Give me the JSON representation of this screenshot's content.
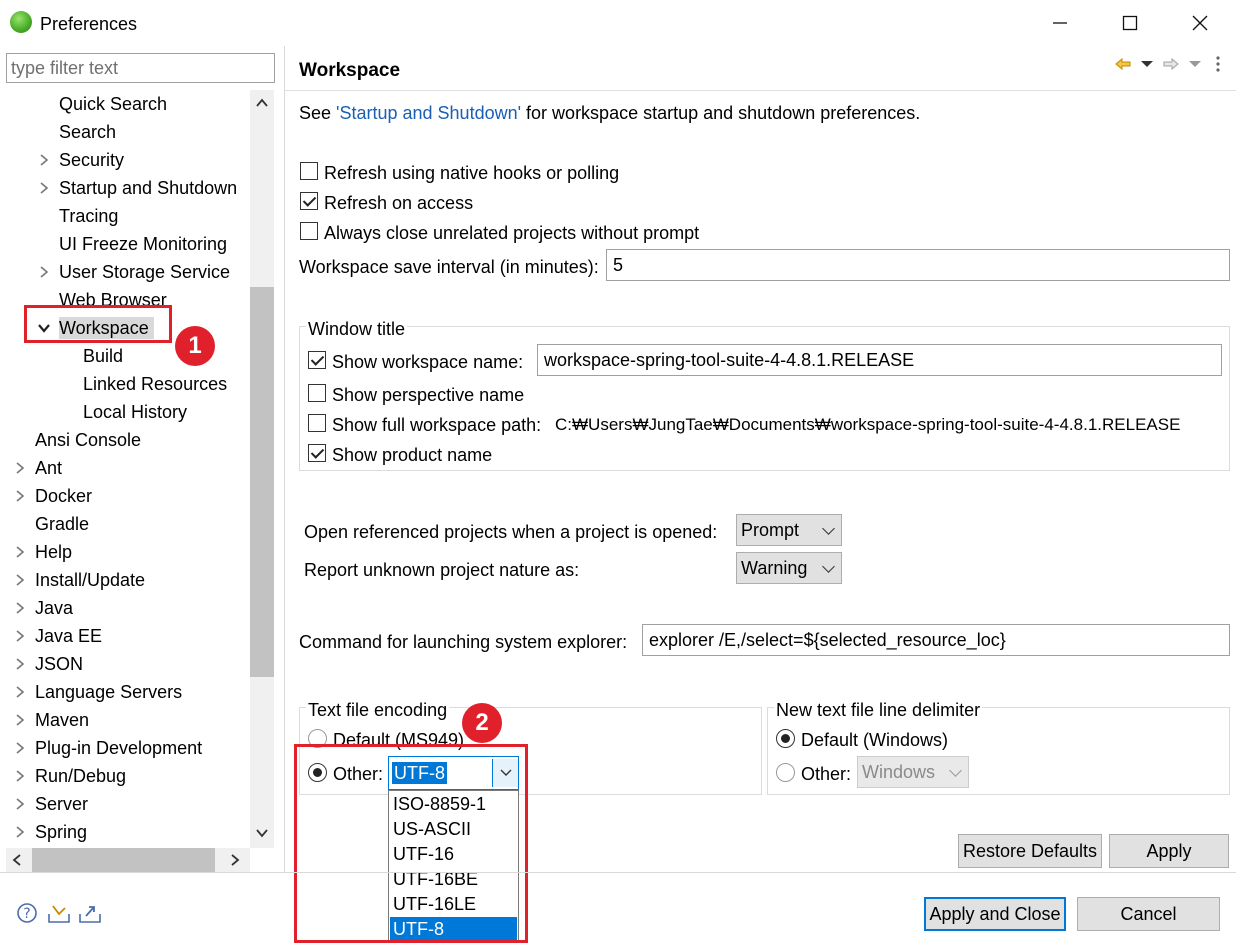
{
  "window": {
    "title": "Preferences"
  },
  "filter": {
    "placeholder": "type filter text"
  },
  "tree": [
    {
      "label": "Quick Search",
      "level": 1,
      "expander": "none"
    },
    {
      "label": "Search",
      "level": 1,
      "expander": "none"
    },
    {
      "label": "Security",
      "level": 1,
      "expander": "collapsed"
    },
    {
      "label": "Startup and Shutdown",
      "level": 1,
      "expander": "collapsed"
    },
    {
      "label": "Tracing",
      "level": 1,
      "expander": "none"
    },
    {
      "label": "UI Freeze Monitoring",
      "level": 1,
      "expander": "none"
    },
    {
      "label": "User Storage Service",
      "level": 1,
      "expander": "collapsed"
    },
    {
      "label": "Web Browser",
      "level": 1,
      "expander": "none"
    },
    {
      "label": "Workspace",
      "level": 1,
      "expander": "expanded",
      "selected": true
    },
    {
      "label": "Build",
      "level": 2,
      "expander": "none"
    },
    {
      "label": "Linked Resources",
      "level": 2,
      "expander": "none"
    },
    {
      "label": "Local History",
      "level": 2,
      "expander": "none"
    },
    {
      "label": "Ansi Console",
      "level": 0,
      "expander": "none"
    },
    {
      "label": "Ant",
      "level": 0,
      "expander": "collapsed"
    },
    {
      "label": "Docker",
      "level": 0,
      "expander": "collapsed"
    },
    {
      "label": "Gradle",
      "level": 0,
      "expander": "none"
    },
    {
      "label": "Help",
      "level": 0,
      "expander": "collapsed"
    },
    {
      "label": "Install/Update",
      "level": 0,
      "expander": "collapsed"
    },
    {
      "label": "Java",
      "level": 0,
      "expander": "collapsed"
    },
    {
      "label": "Java EE",
      "level": 0,
      "expander": "collapsed"
    },
    {
      "label": "JSON",
      "level": 0,
      "expander": "collapsed"
    },
    {
      "label": "Language Servers",
      "level": 0,
      "expander": "collapsed"
    },
    {
      "label": "Maven",
      "level": 0,
      "expander": "collapsed"
    },
    {
      "label": "Plug-in Development",
      "level": 0,
      "expander": "collapsed"
    },
    {
      "label": "Run/Debug",
      "level": 0,
      "expander": "collapsed"
    },
    {
      "label": "Server",
      "level": 0,
      "expander": "collapsed"
    },
    {
      "label": "Spring",
      "level": 0,
      "expander": "collapsed"
    }
  ],
  "page": {
    "title": "Workspace",
    "intro_prefix": "See ",
    "intro_link": "'Startup and Shutdown'",
    "intro_suffix": " for workspace startup and shutdown preferences.",
    "refresh_native": {
      "label": "Refresh using native hooks or polling",
      "checked": false
    },
    "refresh_access": {
      "label": "Refresh on access",
      "checked": true
    },
    "always_close": {
      "label": "Always close unrelated projects without prompt",
      "checked": false
    },
    "save_interval_label": "Workspace save interval (in minutes):",
    "save_interval_value": "5",
    "window_title": {
      "group_label": "Window title",
      "show_ws_name": {
        "label": "Show workspace name:",
        "checked": true,
        "value": "workspace-spring-tool-suite-4-4.8.1.RELEASE"
      },
      "show_perspective": {
        "label": "Show perspective name",
        "checked": false
      },
      "show_full_path": {
        "label": "Show full workspace path:",
        "checked": false,
        "value": "C:₩Users₩JungTae₩Documents₩workspace-spring-tool-suite-4-4.8.1.RELEASE"
      },
      "show_product": {
        "label": "Show product name",
        "checked": true
      }
    },
    "open_referenced": {
      "label": "Open referenced projects when a project is opened:",
      "value": "Prompt"
    },
    "report_unknown": {
      "label": "Report unknown project nature as:",
      "value": "Warning"
    },
    "explorer": {
      "label": "Command for launching system explorer:",
      "value": "explorer /E,/select=${selected_resource_loc}"
    },
    "encoding": {
      "group_label": "Text file encoding",
      "default_label": "Default (MS949)",
      "other_label": "Other:",
      "value": "UTF-8",
      "options": [
        "ISO-8859-1",
        "US-ASCII",
        "UTF-16",
        "UTF-16BE",
        "UTF-16LE",
        "UTF-8"
      ],
      "selected_option": "UTF-8"
    },
    "delimiter": {
      "group_label": "New text file line delimiter",
      "default_label": "Default (Windows)",
      "other_label": "Other:",
      "value": "Windows"
    },
    "restore_defaults": "Restore Defaults",
    "apply": "Apply"
  },
  "footer": {
    "apply_close": "Apply and Close",
    "cancel": "Cancel"
  },
  "annotations": {
    "badge1": "1",
    "badge2": "2"
  },
  "colors": {
    "accent": "#0078d7",
    "annotation_red": "#e0202a",
    "link": "#1a5fb4"
  }
}
